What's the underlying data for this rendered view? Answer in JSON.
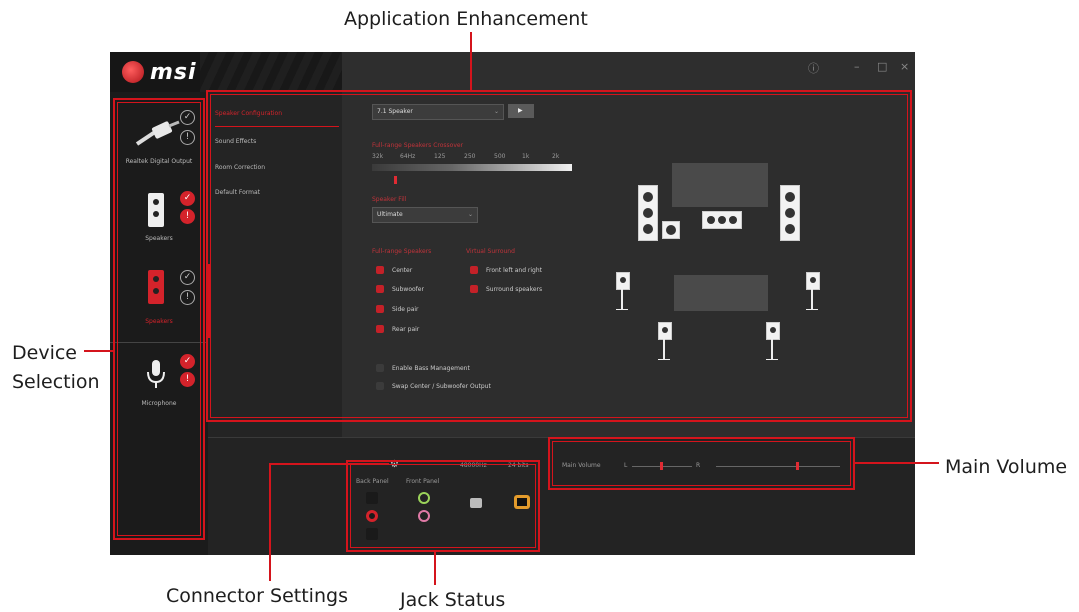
{
  "callouts": {
    "application_enhancement": "Application Enhancement",
    "device_selection_line1": "Device",
    "device_selection_line2": "Selection",
    "main_volume": "Main Volume",
    "connector_settings": "Connector Settings",
    "jack_status": "Jack Status"
  },
  "app": {
    "brand": "msi",
    "window_controls": {
      "info": "ⓘ",
      "minimize": "–",
      "maximize": "□",
      "close": "×"
    }
  },
  "devices": [
    {
      "label": "Realtek Digital Output"
    },
    {
      "label": "Speakers"
    },
    {
      "label": "Speakers"
    },
    {
      "label": "Microphone"
    }
  ],
  "tabs": [
    {
      "label": "Speaker Configuration"
    },
    {
      "label": "Sound Effects"
    },
    {
      "label": "Room Correction"
    },
    {
      "label": "Default Format"
    }
  ],
  "speaker_config": {
    "dropdown_value": "7.1 Speaker",
    "play_button": "▶",
    "eq_heading": "Full-range Speakers Crossover",
    "eq_ticks": [
      "32k",
      "64Hz",
      "125",
      "250",
      "500",
      "1k",
      "2k"
    ],
    "preset_heading": "Speaker Fill",
    "preset_value": "Ultimate",
    "group1_heading": "Full-range Speakers",
    "group1": [
      "Center",
      "Subwoofer",
      "Side pair",
      "Rear pair"
    ],
    "group2_heading": "Virtual Surround",
    "group2": [
      "Front left and right",
      "Surround speakers"
    ],
    "options": [
      "Enable Bass Management",
      "Swap Center / Subwoofer Output"
    ]
  },
  "bottom": {
    "sample_rate": "48000Hz",
    "bit_depth": "24 bits",
    "analog_label": "Back Panel",
    "front_label": "Front Panel",
    "main_volume_label": "Main Volume",
    "vol_left": "L",
    "vol_right": "R"
  }
}
